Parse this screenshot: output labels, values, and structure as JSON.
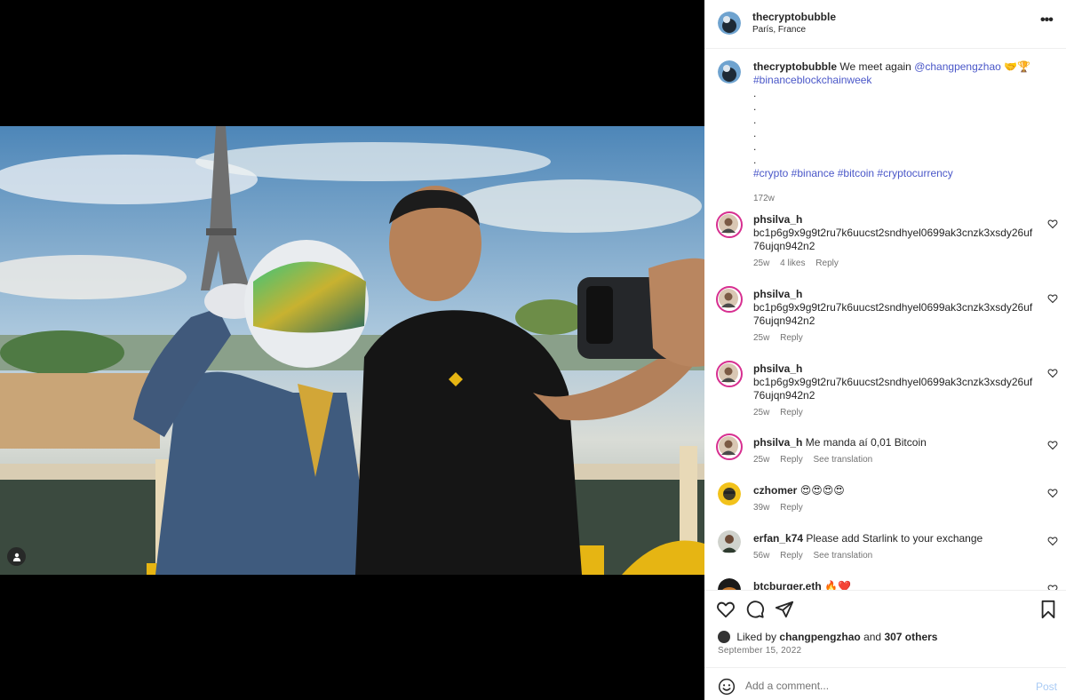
{
  "post": {
    "username": "thecryptobubble",
    "location": "París, France",
    "caption_user": "thecryptobubble",
    "caption_text": "We meet again",
    "caption_mention": "@changpengzhao",
    "caption_emojis": "🤝🏆",
    "caption_hashtag_1": "#binanceblockchainweek",
    "caption_dots": [
      ".",
      ".",
      ".",
      ".",
      ".",
      "."
    ],
    "caption_hashtags_2": "#crypto #binance #bitcoin #cryptocurrency",
    "caption_time": "172w",
    "likes_prefix": "Liked by",
    "likes_user": "changpengzhao",
    "likes_and": "and",
    "likes_others": "307 others",
    "date": "September 15, 2022"
  },
  "comments": [
    {
      "user": "phsilva_h",
      "text": "bc1p6g9x9g9t2ru7k6uucst2sndhyel0699ak3cnzk3xsdy26uf76ujqn942n2",
      "time": "25w",
      "likes": "4 likes",
      "reply": "Reply"
    },
    {
      "user": "phsilva_h",
      "text": "bc1p6g9x9g9t2ru7k6uucst2sndhyel0699ak3cnzk3xsdy26uf76ujqn942n2",
      "time": "25w",
      "reply": "Reply"
    },
    {
      "user": "phsilva_h",
      "text": "bc1p6g9x9g9t2ru7k6uucst2sndhyel0699ak3cnzk3xsdy26uf76ujqn942n2",
      "time": "25w",
      "reply": "Reply"
    },
    {
      "user": "phsilva_h",
      "text": "Me manda aí 0,01 Bitcoin",
      "time": "25w",
      "reply": "Reply",
      "translate": "See translation"
    },
    {
      "user": "czhomer",
      "text": "😍😍😍😍",
      "time": "39w",
      "reply": "Reply"
    },
    {
      "user": "erfan_k74",
      "text": "Please add Starlink to your exchange",
      "time": "56w",
      "reply": "Reply",
      "translate": "See translation"
    },
    {
      "user": "btcburger.eth",
      "text": "🔥❤️"
    }
  ],
  "composer": {
    "placeholder": "Add a comment...",
    "post_label": "Post"
  },
  "icons": {
    "more": "more-options-icon",
    "heart": "heart-icon",
    "comment": "comment-icon",
    "share": "share-icon",
    "save": "bookmark-icon",
    "emoji": "emoji-icon",
    "user_tag": "user-tag-icon"
  },
  "colors": {
    "link": "#4a57c8",
    "post_button": "#a9cbf5",
    "story_ring": "#d72f90"
  }
}
